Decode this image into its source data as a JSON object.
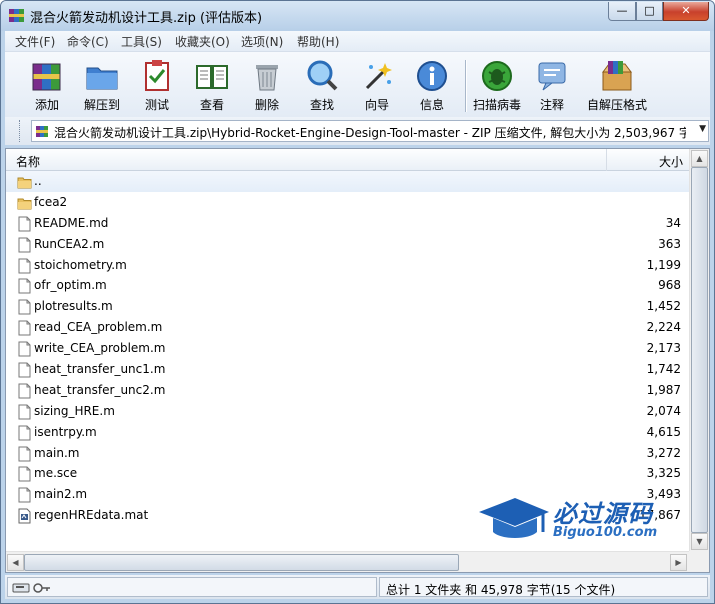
{
  "window": {
    "title": "混合火箭发动机设计工具.zip (评估版本)",
    "min_glyph": "—",
    "max_glyph": "□",
    "close_glyph": "✕"
  },
  "menu": {
    "items": [
      {
        "label": "文件(F)"
      },
      {
        "label": "命令(C)"
      },
      {
        "label": "工具(S)"
      },
      {
        "label": "收藏夹(O)"
      },
      {
        "label": "选项(N)"
      },
      {
        "label": "帮助(H)"
      }
    ]
  },
  "toolbar": {
    "items": [
      {
        "label": "添加",
        "icon": "add-archive-icon"
      },
      {
        "label": "解压到",
        "icon": "extract-to-icon"
      },
      {
        "label": "测试",
        "icon": "test-icon"
      },
      {
        "label": "查看",
        "icon": "view-icon"
      },
      {
        "label": "删除",
        "icon": "delete-icon"
      },
      {
        "label": "查找",
        "icon": "find-icon"
      },
      {
        "label": "向导",
        "icon": "wizard-icon"
      },
      {
        "label": "信息",
        "icon": "info-icon"
      },
      {
        "label": "扫描病毒",
        "icon": "virus-scan-icon"
      },
      {
        "label": "注释",
        "icon": "comment-icon"
      },
      {
        "label": "自解压格式",
        "icon": "sfx-icon"
      }
    ]
  },
  "address": {
    "path": "混合火箭发动机设计工具.zip\\Hybrid-Rocket-Engine-Design-Tool-master - ZIP 压缩文件, 解包大小为 2,503,967 字节"
  },
  "filelist": {
    "columns": {
      "name": "名称",
      "size": "大小"
    },
    "rows": [
      {
        "name": "..",
        "size": "",
        "icon": "up-folder-icon"
      },
      {
        "name": "fcea2",
        "size": "",
        "icon": "folder-icon"
      },
      {
        "name": "README.md",
        "size": "34",
        "icon": "file-icon"
      },
      {
        "name": "RunCEA2.m",
        "size": "363",
        "icon": "file-icon"
      },
      {
        "name": "stoichometry.m",
        "size": "1,199",
        "icon": "file-icon"
      },
      {
        "name": "ofr_optim.m",
        "size": "968",
        "icon": "file-icon"
      },
      {
        "name": "plotresults.m",
        "size": "1,452",
        "icon": "file-icon"
      },
      {
        "name": "read_CEA_problem.m",
        "size": "2,224",
        "icon": "file-icon"
      },
      {
        "name": "write_CEA_problem.m",
        "size": "2,173",
        "icon": "file-icon"
      },
      {
        "name": "heat_transfer_unc1.m",
        "size": "1,742",
        "icon": "file-icon"
      },
      {
        "name": "heat_transfer_unc2.m",
        "size": "1,987",
        "icon": "file-icon"
      },
      {
        "name": "sizing_HRE.m",
        "size": "2,074",
        "icon": "file-icon"
      },
      {
        "name": "isentrpy.m",
        "size": "4,615",
        "icon": "file-icon"
      },
      {
        "name": "main.m",
        "size": "3,272",
        "icon": "file-icon"
      },
      {
        "name": "me.sce",
        "size": "3,325",
        "icon": "file-icon"
      },
      {
        "name": "main2.m",
        "size": "3,493",
        "icon": "file-icon"
      },
      {
        "name": "regenHREdata.mat",
        "size": "17,867",
        "icon": "mat-file-icon"
      }
    ]
  },
  "status": {
    "summary": "总计 1 文件夹 和 45,978 字节(15 个文件)"
  },
  "watermark": {
    "main": "必过源码",
    "sub": "Biguo100.com"
  },
  "colors": {
    "titlebar": "#c6dbf0",
    "accent": "#1d5fb4",
    "close": "#c8412c"
  }
}
